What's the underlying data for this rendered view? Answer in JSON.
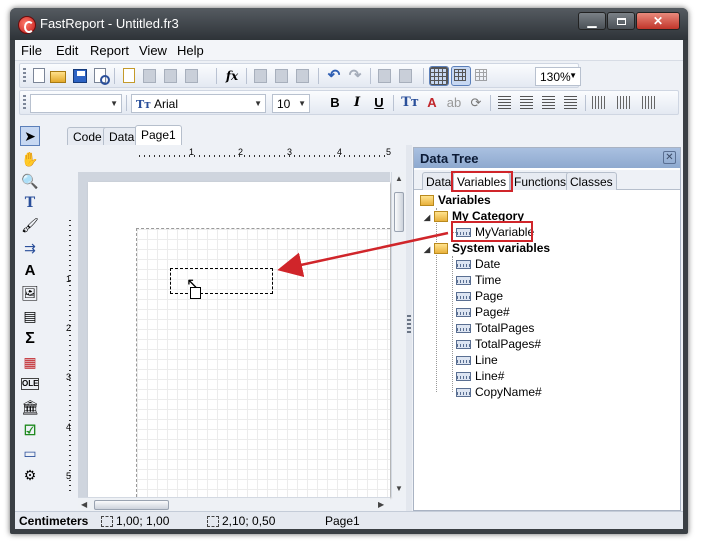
{
  "window": {
    "title": "FastReport - Untitled.fr3"
  },
  "menu": [
    "File",
    "Edit",
    "Report",
    "View",
    "Help"
  ],
  "toolbar": {
    "zoom": "130%"
  },
  "format_bar": {
    "font_name": "Arial",
    "font_size": "10",
    "bold": "B",
    "italic": "I",
    "underline": "U"
  },
  "tools": {
    "text": "T",
    "big_text": "A",
    "sum": "Σ",
    "ole": "OLE"
  },
  "designer_tabs": [
    "Code",
    "Data",
    "Page1"
  ],
  "ruler": {
    "h": [
      "1",
      "2",
      "3",
      "4",
      "5"
    ],
    "v": [
      "1",
      "2",
      "3",
      "4",
      "5"
    ]
  },
  "data_tree": {
    "title": "Data Tree",
    "tabs": [
      "Data",
      "Variables",
      "Functions",
      "Classes"
    ],
    "root": "Variables",
    "category": "My Category",
    "user_var": "MyVariable",
    "system_group": "System variables",
    "system_vars": [
      "Date",
      "Time",
      "Page",
      "Page#",
      "TotalPages",
      "TotalPages#",
      "Line",
      "Line#",
      "CopyName#"
    ]
  },
  "status": {
    "units": "Centimeters",
    "position": "1,00; 1,00",
    "size": "2,10; 0,50",
    "page": "Page1"
  },
  "colors": {
    "highlight": "#d0252a",
    "panel_header": "#9db4d8",
    "title_bar": "#3a3f44"
  }
}
